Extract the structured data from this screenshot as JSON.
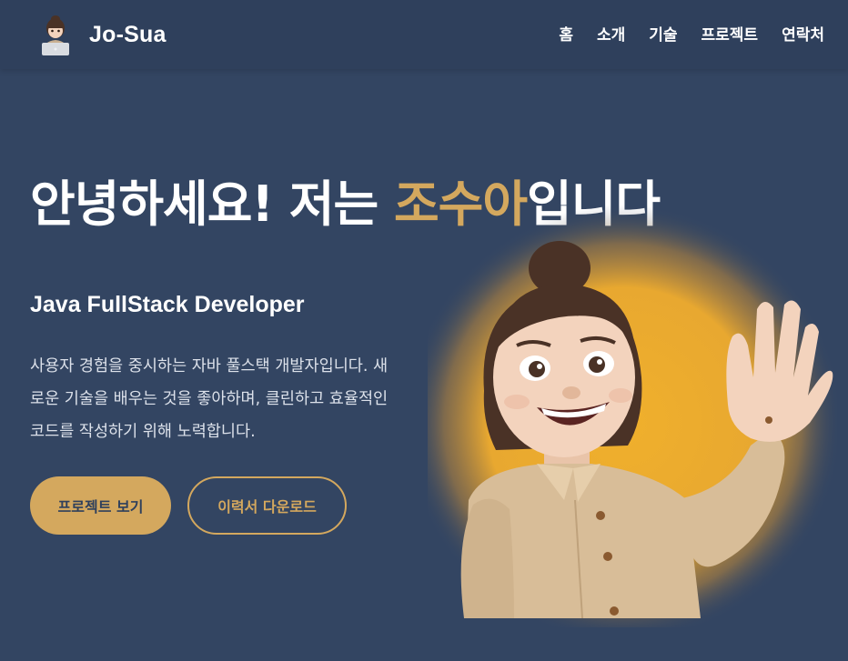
{
  "brand": {
    "name": "Jo-Sua",
    "avatar_icon": "memoji-laptop-icon"
  },
  "nav": {
    "items": [
      {
        "label": "홈"
      },
      {
        "label": "소개"
      },
      {
        "label": "기술"
      },
      {
        "label": "프로젝트"
      },
      {
        "label": "연락처"
      }
    ]
  },
  "hero": {
    "title_before": "안녕하세요! 저는 ",
    "title_highlight": "조수아",
    "title_after": "입니다",
    "subtitle": "Java FullStack Developer",
    "description": "사용자 경험을 중시하는 자바 풀스택 개발자입니다. 새로운 기술을 배우는 것을 좋아하며, 클린하고 효율적인 코드를 작성하기 위해 노력합니다.",
    "primary_button": "프로젝트 보기",
    "secondary_button": "이력서 다운로드",
    "illustration_icon": "waving-memoji-icon"
  },
  "colors": {
    "background": "#334562",
    "navbar": "#2f405c",
    "accent": "#d4a85e",
    "glow": "#e8a830"
  }
}
